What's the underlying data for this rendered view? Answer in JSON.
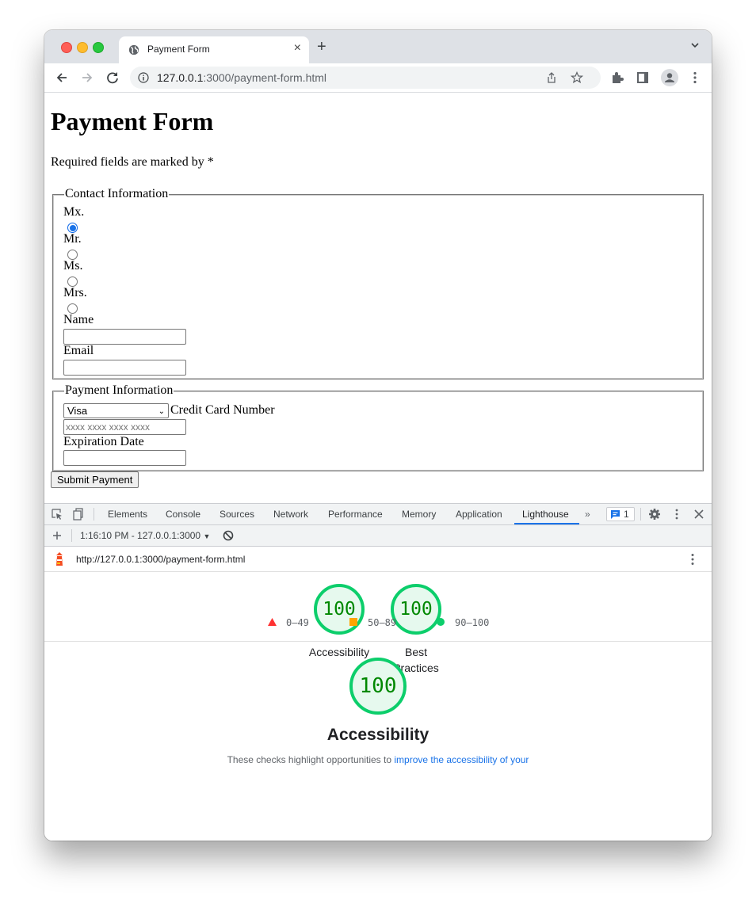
{
  "browser": {
    "tab_title": "Payment Form",
    "url_host": "127.0.0.1",
    "url_path": ":3000/payment-form.html",
    "icons": [
      "globe-icon",
      "close-icon",
      "plus-icon",
      "chevron-down-icon",
      "back-icon",
      "forward-icon",
      "reload-icon",
      "info-icon",
      "share-icon",
      "star-icon",
      "extensions-icon",
      "side-panel-icon",
      "profile-icon",
      "menu-icon"
    ]
  },
  "page": {
    "heading": "Payment Form",
    "required_note": "Required fields are marked by *",
    "contact": {
      "legend": "Contact Information",
      "titles": [
        {
          "label": "Mx.",
          "checked": true
        },
        {
          "label": "Mr.",
          "checked": false
        },
        {
          "label": "Ms.",
          "checked": false
        },
        {
          "label": "Mrs.",
          "checked": false
        }
      ],
      "name_label": "Name",
      "name_value": "",
      "email_label": "Email",
      "email_value": ""
    },
    "payment": {
      "legend": "Payment Information",
      "card_type_selected": "Visa",
      "card_number_label": "Credit Card Number",
      "card_number_placeholder": "xxxx xxxx xxxx xxxx",
      "expiration_label": "Expiration Date",
      "expiration_value": ""
    },
    "submit_label": "Submit Payment"
  },
  "devtools": {
    "tabs": [
      "Elements",
      "Console",
      "Sources",
      "Network",
      "Performance",
      "Memory",
      "Application",
      "Lighthouse"
    ],
    "active_tab": "Lighthouse",
    "more_tabs": "»",
    "issues_count": "1",
    "report_selector": "1:16:10 PM - 127.0.0.1:3000",
    "report_url": "http://127.0.0.1:3000/payment-form.html"
  },
  "lighthouse": {
    "scores": [
      {
        "category": "Accessibility",
        "score": "100"
      },
      {
        "category": "Best Practices",
        "score": "100"
      }
    ],
    "legend": [
      {
        "range": "0–49",
        "shape": "triangle",
        "color": "#ff3333"
      },
      {
        "range": "50–89",
        "shape": "square",
        "color": "#ffa400"
      },
      {
        "range": "90–100",
        "shape": "circle",
        "color": "#0cce6b"
      }
    ],
    "section": {
      "score": "100",
      "title": "Accessibility",
      "description_prefix": "These checks highlight opportunities to ",
      "description_link": "improve the accessibility of your"
    },
    "colors": {
      "pass": "#0cce6b",
      "pass_text": "#008800",
      "accent": "#1a73e8"
    }
  }
}
